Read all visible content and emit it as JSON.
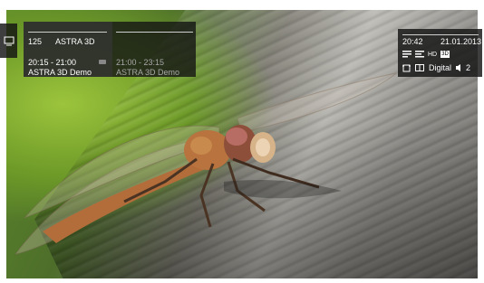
{
  "channel": {
    "number": "125",
    "name": "ASTRA 3D"
  },
  "now": {
    "time": "20:15 - 21:00",
    "title": "ASTRA 3D Demo"
  },
  "next": {
    "time": "21:00 - 23:15",
    "title": "ASTRA 3D Demo"
  },
  "status": {
    "clock": "20:42",
    "date": "21.01.2013",
    "audio_label": "Digital",
    "audio_tracks": "2",
    "hd_badge": "HD",
    "sd_badge": "3D"
  },
  "icons": [
    "tv-icon",
    "list-icon",
    "teletext-icon",
    "hd-icon",
    "3d-icon",
    "aspect-icon",
    "dolby-icon",
    "speaker-icon"
  ]
}
